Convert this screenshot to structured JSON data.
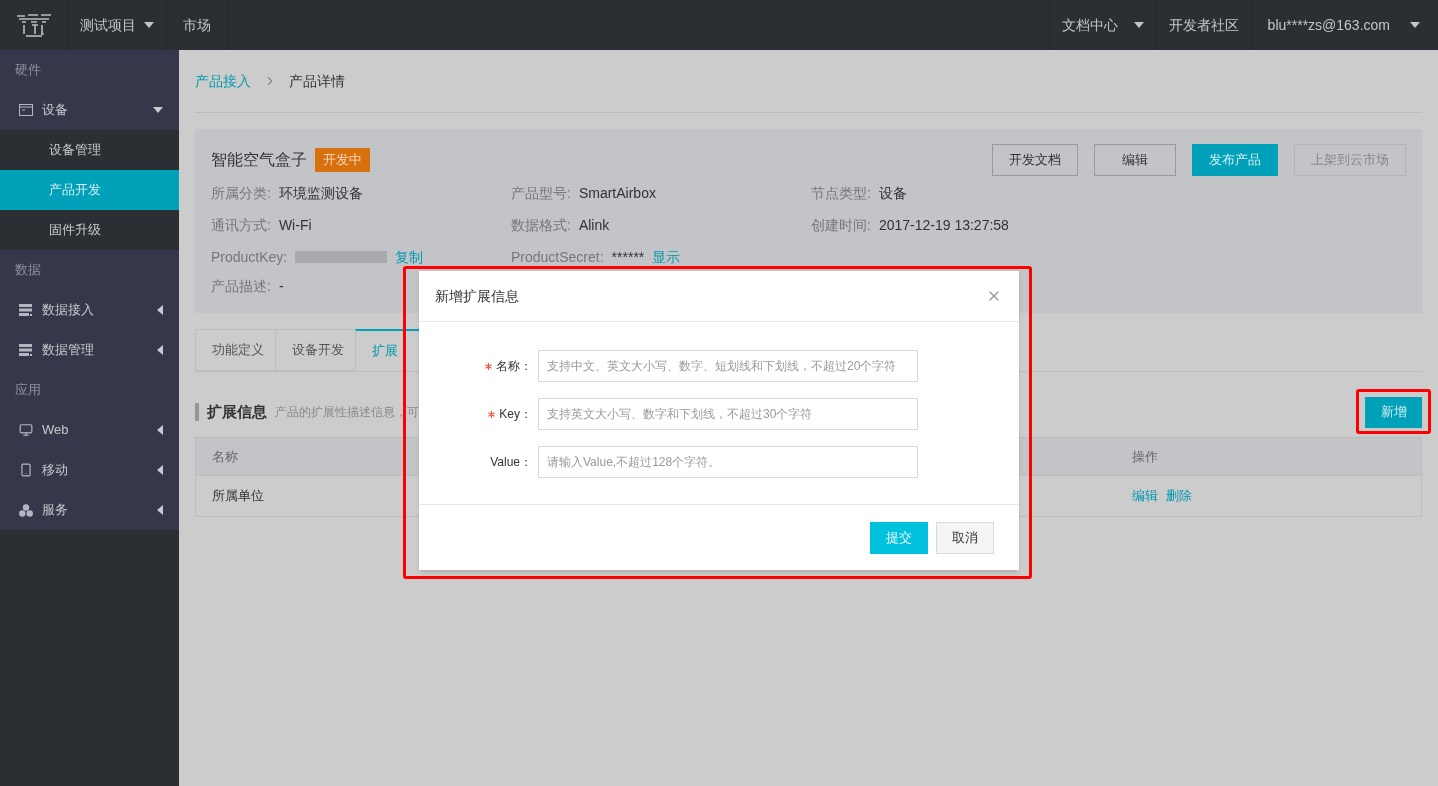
{
  "topbar": {
    "project": "测试项目",
    "nav": [
      "市场"
    ],
    "right": [
      {
        "label": "文档中心",
        "dropdown": true
      },
      {
        "label": "开发者社区",
        "dropdown": false
      },
      {
        "label": "blu****zs@163.com",
        "dropdown": true
      }
    ]
  },
  "sidebar": {
    "groups": [
      {
        "title": "硬件",
        "items": [
          {
            "label": "设备",
            "expanded": true,
            "children": [
              {
                "label": "设备管理",
                "selected": false
              },
              {
                "label": "产品开发",
                "selected": true
              },
              {
                "label": "固件升级",
                "selected": false
              }
            ]
          }
        ]
      },
      {
        "title": "数据",
        "items": [
          {
            "label": "数据接入",
            "expanded": false
          },
          {
            "label": "数据管理",
            "expanded": false
          }
        ]
      },
      {
        "title": "应用",
        "items": [
          {
            "label": "Web",
            "expanded": false
          },
          {
            "label": "移动",
            "expanded": false
          },
          {
            "label": "服务",
            "expanded": false
          }
        ]
      }
    ]
  },
  "breadcrumb": [
    "产品接入",
    "产品详情"
  ],
  "product": {
    "title": "智能空气盒子",
    "status": "开发中",
    "buttons": [
      {
        "label": "开发文档",
        "kind": "default"
      },
      {
        "label": "编辑",
        "kind": "default"
      },
      {
        "label": "发布产品",
        "kind": "primary"
      },
      {
        "label": "上架到云市场",
        "kind": "disabled"
      }
    ],
    "fields": [
      {
        "kind": "text",
        "label": "所属分类:",
        "value": "环境监测设备"
      },
      {
        "kind": "text",
        "label": "产品型号:",
        "value": "SmartAirbox"
      },
      {
        "kind": "text",
        "label": "节点类型:",
        "value": "设备"
      },
      {
        "kind": "text",
        "label": "通讯方式:",
        "value": "Wi-Fi"
      },
      {
        "kind": "text",
        "label": "数据格式:",
        "value": "Alink"
      },
      {
        "kind": "text",
        "label": "创建时间:",
        "value": "2017-12-19 13:27:58"
      },
      {
        "kind": "masked",
        "label": "ProductKey:",
        "link": "复制"
      },
      {
        "kind": "secret",
        "label": "ProductSecret:",
        "value": "******",
        "link": "显示"
      },
      {
        "kind": "empty"
      }
    ],
    "description": {
      "label": "产品描述:",
      "text": "-"
    }
  },
  "tabs": [
    {
      "label": "功能定义",
      "selected": false
    },
    {
      "label": "设备开发",
      "selected": false
    },
    {
      "label": "扩展",
      "selected": true
    }
  ],
  "section": {
    "title": "扩展信息",
    "description": "产品的扩展性描述信息，可",
    "add_button": "新增"
  },
  "table": {
    "columns": [
      "名称",
      "操作"
    ],
    "rows": [
      {
        "name": "所属单位",
        "actions": [
          "编辑",
          "删除"
        ]
      }
    ]
  },
  "dialog": {
    "title": "新增扩展信息",
    "fields": [
      {
        "label": "名称：",
        "required": true,
        "placeholder": "支持中文、英文大小写、数字、短划线和下划线，不超过20个字符"
      },
      {
        "label": "Key：",
        "required": true,
        "placeholder": "支持英文大小写、数字和下划线，不超过30个字符"
      },
      {
        "label": "Value：",
        "required": false,
        "placeholder": "请输入Value,不超过128个字符。"
      }
    ],
    "buttons": [
      {
        "label": "提交",
        "kind": "primary"
      },
      {
        "label": "取消",
        "kind": "default"
      }
    ]
  }
}
